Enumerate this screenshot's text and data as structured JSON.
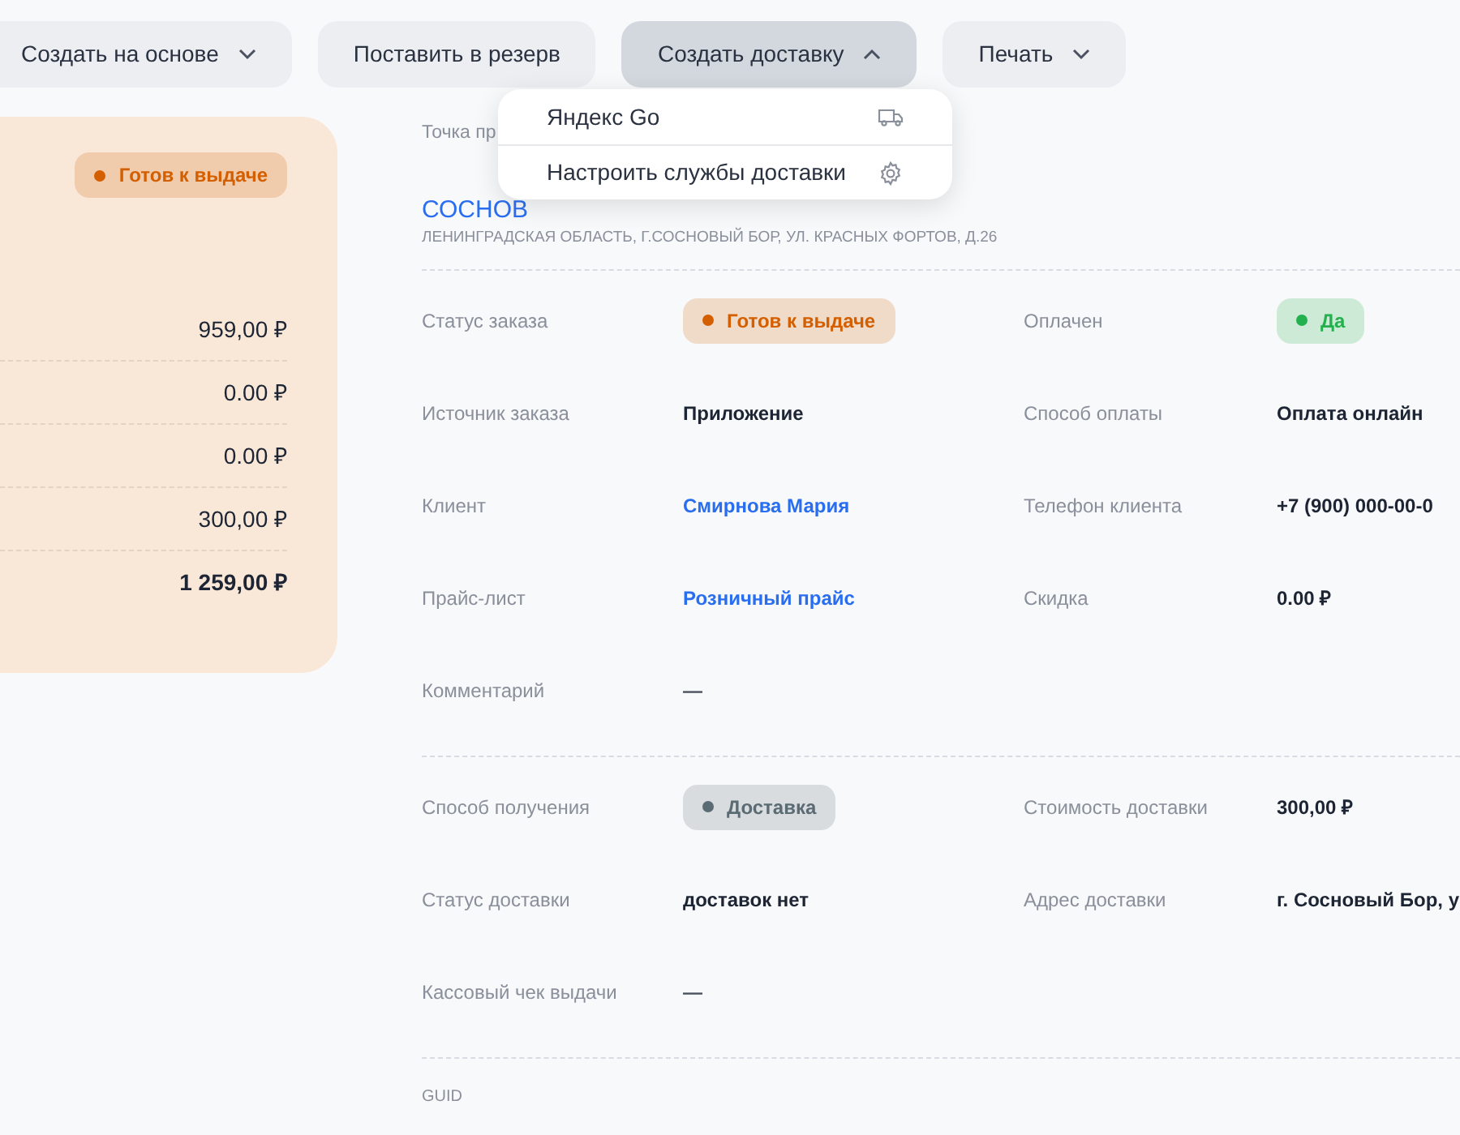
{
  "toolbar": {
    "buttons": [
      {
        "label": "Создать на основе",
        "kind": "dropdown",
        "expanded": false
      },
      {
        "label": "Поставить в резерв",
        "kind": "plain",
        "expanded": false
      },
      {
        "label": "Создать доставку",
        "kind": "dropdown",
        "expanded": true
      },
      {
        "label": "Печать",
        "kind": "dropdown",
        "expanded": false
      }
    ]
  },
  "dropdown_menu": {
    "items": [
      {
        "label": "Яндекс Go",
        "kind": "truck"
      },
      {
        "label": "Настроить службы доставки",
        "kind": "gear"
      }
    ]
  },
  "summary_card": {
    "status_badge": {
      "label": "Готов к выдаче",
      "color": "#d35f00"
    },
    "amounts": [
      {
        "value": "959,00 ₽",
        "kind": "line"
      },
      {
        "value": "0.00 ₽",
        "kind": "line"
      },
      {
        "value": "0.00 ₽",
        "kind": "line"
      },
      {
        "value": "300,00 ₽",
        "kind": "line"
      },
      {
        "value": "1 259,00 ₽",
        "kind": "total"
      }
    ]
  },
  "pickup_point": {
    "label": "Точка пр",
    "name": "СОСНОВ",
    "address": "ЛЕНИНГРАДСКАЯ ОБЛАСТЬ, Г.СОСНОВЫЙ БОР, УЛ. КРАСНЫХ ФОРТОВ, Д.26"
  },
  "sections": [
    {
      "rows": [
        [
          {
            "label": "Статус заказа",
            "value": "Готов к выдаче",
            "kind": "badge",
            "color": "#d35f00"
          },
          {
            "label": "Оплачен",
            "value": "Да",
            "kind": "badge",
            "color": "#22b14c"
          }
        ],
        [
          {
            "label": "Источник заказа",
            "value": "Приложение",
            "kind": "text"
          },
          {
            "label": "Способ оплаты",
            "value": "Оплата онлайн",
            "kind": "text"
          }
        ],
        [
          {
            "label": "Клиент",
            "value": "Смирнова Мария",
            "kind": "link"
          },
          {
            "label": "Телефон клиента",
            "value": "+7 (900) 000-00-0",
            "kind": "text"
          }
        ],
        [
          {
            "label": "Прайс-лист",
            "value": "Розничный прайс",
            "kind": "link"
          },
          {
            "label": "Скидка",
            "value": "0.00 ₽",
            "kind": "text"
          }
        ],
        [
          {
            "label": "Комментарий",
            "value": "—",
            "kind": "dash"
          }
        ]
      ]
    },
    {
      "rows": [
        [
          {
            "label": "Способ получения",
            "value": "Доставка",
            "kind": "badge",
            "color": "#5b6b73"
          },
          {
            "label": "Стоимость доставки",
            "value": "300,00 ₽",
            "kind": "text"
          }
        ],
        [
          {
            "label": "Статус доставки",
            "value": "доставок нет",
            "kind": "text"
          },
          {
            "label": "Адрес доставки",
            "value": "г. Сосновый Бор, у",
            "kind": "text"
          }
        ],
        [
          {
            "label": "Кассовый чек выдачи",
            "value": "—",
            "kind": "dash"
          }
        ]
      ]
    }
  ],
  "footer_label": "GUID"
}
